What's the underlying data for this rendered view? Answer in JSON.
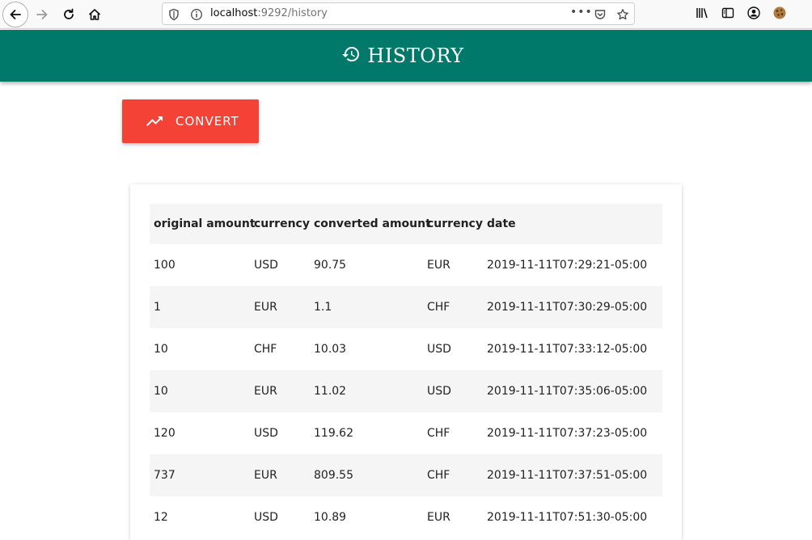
{
  "browser": {
    "url_host": "localhost",
    "url_rest": ":9292/history",
    "page_actions_icon": "•••"
  },
  "header": {
    "title": "HISTORY",
    "icon": "history-icon"
  },
  "convert_button": {
    "label": "CONVERT",
    "icon": "trending-up-icon"
  },
  "table": {
    "headers": [
      "original amount",
      "currency",
      "converted amount",
      "currency",
      "date"
    ],
    "rows": [
      [
        "100",
        "USD",
        "90.75",
        "EUR",
        "2019-11-11T07:29:21-05:00"
      ],
      [
        "1",
        "EUR",
        "1.1",
        "CHF",
        "2019-11-11T07:30:29-05:00"
      ],
      [
        "10",
        "CHF",
        "10.03",
        "USD",
        "2019-11-11T07:33:12-05:00"
      ],
      [
        "10",
        "EUR",
        "11.02",
        "USD",
        "2019-11-11T07:35:06-05:00"
      ],
      [
        "120",
        "USD",
        "119.62",
        "CHF",
        "2019-11-11T07:37:23-05:00"
      ],
      [
        "737",
        "EUR",
        "809.55",
        "CHF",
        "2019-11-11T07:37:51-05:00"
      ],
      [
        "12",
        "USD",
        "10.89",
        "EUR",
        "2019-11-11T07:51:30-05:00"
      ]
    ]
  },
  "colors": {
    "header_bg": "#00796b",
    "convert_bg": "#f44336",
    "row_alt_bg": "#f5f5f5"
  }
}
